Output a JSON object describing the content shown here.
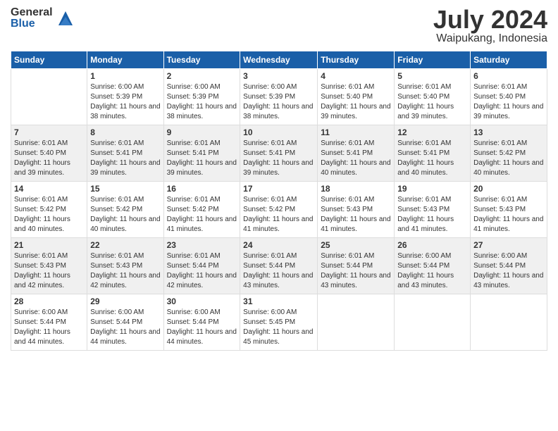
{
  "logo": {
    "general": "General",
    "blue": "Blue"
  },
  "title": {
    "month_year": "July 2024",
    "location": "Waipukang, Indonesia"
  },
  "weekdays": [
    "Sunday",
    "Monday",
    "Tuesday",
    "Wednesday",
    "Thursday",
    "Friday",
    "Saturday"
  ],
  "weeks": [
    [
      {
        "day": "",
        "sunrise": "",
        "sunset": "",
        "daylight": ""
      },
      {
        "day": "1",
        "sunrise": "Sunrise: 6:00 AM",
        "sunset": "Sunset: 5:39 PM",
        "daylight": "Daylight: 11 hours and 38 minutes."
      },
      {
        "day": "2",
        "sunrise": "Sunrise: 6:00 AM",
        "sunset": "Sunset: 5:39 PM",
        "daylight": "Daylight: 11 hours and 38 minutes."
      },
      {
        "day": "3",
        "sunrise": "Sunrise: 6:00 AM",
        "sunset": "Sunset: 5:39 PM",
        "daylight": "Daylight: 11 hours and 38 minutes."
      },
      {
        "day": "4",
        "sunrise": "Sunrise: 6:01 AM",
        "sunset": "Sunset: 5:40 PM",
        "daylight": "Daylight: 11 hours and 39 minutes."
      },
      {
        "day": "5",
        "sunrise": "Sunrise: 6:01 AM",
        "sunset": "Sunset: 5:40 PM",
        "daylight": "Daylight: 11 hours and 39 minutes."
      },
      {
        "day": "6",
        "sunrise": "Sunrise: 6:01 AM",
        "sunset": "Sunset: 5:40 PM",
        "daylight": "Daylight: 11 hours and 39 minutes."
      }
    ],
    [
      {
        "day": "7",
        "sunrise": "Sunrise: 6:01 AM",
        "sunset": "Sunset: 5:40 PM",
        "daylight": "Daylight: 11 hours and 39 minutes."
      },
      {
        "day": "8",
        "sunrise": "Sunrise: 6:01 AM",
        "sunset": "Sunset: 5:41 PM",
        "daylight": "Daylight: 11 hours and 39 minutes."
      },
      {
        "day": "9",
        "sunrise": "Sunrise: 6:01 AM",
        "sunset": "Sunset: 5:41 PM",
        "daylight": "Daylight: 11 hours and 39 minutes."
      },
      {
        "day": "10",
        "sunrise": "Sunrise: 6:01 AM",
        "sunset": "Sunset: 5:41 PM",
        "daylight": "Daylight: 11 hours and 39 minutes."
      },
      {
        "day": "11",
        "sunrise": "Sunrise: 6:01 AM",
        "sunset": "Sunset: 5:41 PM",
        "daylight": "Daylight: 11 hours and 40 minutes."
      },
      {
        "day": "12",
        "sunrise": "Sunrise: 6:01 AM",
        "sunset": "Sunset: 5:41 PM",
        "daylight": "Daylight: 11 hours and 40 minutes."
      },
      {
        "day": "13",
        "sunrise": "Sunrise: 6:01 AM",
        "sunset": "Sunset: 5:42 PM",
        "daylight": "Daylight: 11 hours and 40 minutes."
      }
    ],
    [
      {
        "day": "14",
        "sunrise": "Sunrise: 6:01 AM",
        "sunset": "Sunset: 5:42 PM",
        "daylight": "Daylight: 11 hours and 40 minutes."
      },
      {
        "day": "15",
        "sunrise": "Sunrise: 6:01 AM",
        "sunset": "Sunset: 5:42 PM",
        "daylight": "Daylight: 11 hours and 40 minutes."
      },
      {
        "day": "16",
        "sunrise": "Sunrise: 6:01 AM",
        "sunset": "Sunset: 5:42 PM",
        "daylight": "Daylight: 11 hours and 41 minutes."
      },
      {
        "day": "17",
        "sunrise": "Sunrise: 6:01 AM",
        "sunset": "Sunset: 5:42 PM",
        "daylight": "Daylight: 11 hours and 41 minutes."
      },
      {
        "day": "18",
        "sunrise": "Sunrise: 6:01 AM",
        "sunset": "Sunset: 5:43 PM",
        "daylight": "Daylight: 11 hours and 41 minutes."
      },
      {
        "day": "19",
        "sunrise": "Sunrise: 6:01 AM",
        "sunset": "Sunset: 5:43 PM",
        "daylight": "Daylight: 11 hours and 41 minutes."
      },
      {
        "day": "20",
        "sunrise": "Sunrise: 6:01 AM",
        "sunset": "Sunset: 5:43 PM",
        "daylight": "Daylight: 11 hours and 41 minutes."
      }
    ],
    [
      {
        "day": "21",
        "sunrise": "Sunrise: 6:01 AM",
        "sunset": "Sunset: 5:43 PM",
        "daylight": "Daylight: 11 hours and 42 minutes."
      },
      {
        "day": "22",
        "sunrise": "Sunrise: 6:01 AM",
        "sunset": "Sunset: 5:43 PM",
        "daylight": "Daylight: 11 hours and 42 minutes."
      },
      {
        "day": "23",
        "sunrise": "Sunrise: 6:01 AM",
        "sunset": "Sunset: 5:44 PM",
        "daylight": "Daylight: 11 hours and 42 minutes."
      },
      {
        "day": "24",
        "sunrise": "Sunrise: 6:01 AM",
        "sunset": "Sunset: 5:44 PM",
        "daylight": "Daylight: 11 hours and 43 minutes."
      },
      {
        "day": "25",
        "sunrise": "Sunrise: 6:01 AM",
        "sunset": "Sunset: 5:44 PM",
        "daylight": "Daylight: 11 hours and 43 minutes."
      },
      {
        "day": "26",
        "sunrise": "Sunrise: 6:00 AM",
        "sunset": "Sunset: 5:44 PM",
        "daylight": "Daylight: 11 hours and 43 minutes."
      },
      {
        "day": "27",
        "sunrise": "Sunrise: 6:00 AM",
        "sunset": "Sunset: 5:44 PM",
        "daylight": "Daylight: 11 hours and 43 minutes."
      }
    ],
    [
      {
        "day": "28",
        "sunrise": "Sunrise: 6:00 AM",
        "sunset": "Sunset: 5:44 PM",
        "daylight": "Daylight: 11 hours and 44 minutes."
      },
      {
        "day": "29",
        "sunrise": "Sunrise: 6:00 AM",
        "sunset": "Sunset: 5:44 PM",
        "daylight": "Daylight: 11 hours and 44 minutes."
      },
      {
        "day": "30",
        "sunrise": "Sunrise: 6:00 AM",
        "sunset": "Sunset: 5:44 PM",
        "daylight": "Daylight: 11 hours and 44 minutes."
      },
      {
        "day": "31",
        "sunrise": "Sunrise: 6:00 AM",
        "sunset": "Sunset: 5:45 PM",
        "daylight": "Daylight: 11 hours and 45 minutes."
      },
      {
        "day": "",
        "sunrise": "",
        "sunset": "",
        "daylight": ""
      },
      {
        "day": "",
        "sunrise": "",
        "sunset": "",
        "daylight": ""
      },
      {
        "day": "",
        "sunrise": "",
        "sunset": "",
        "daylight": ""
      }
    ]
  ]
}
